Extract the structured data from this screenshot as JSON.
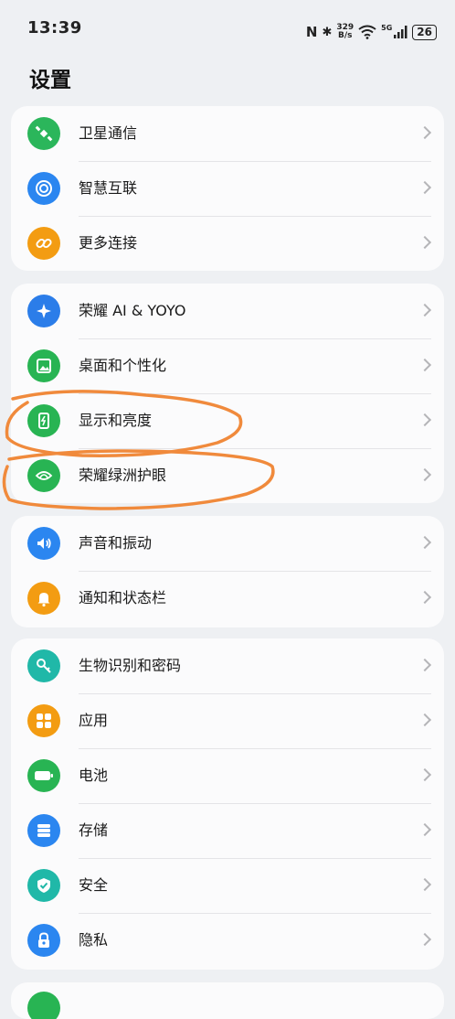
{
  "status_bar": {
    "time": "13:39",
    "nfc": "N",
    "bluetooth": "✱",
    "speed_top": "329",
    "speed_bottom": "B/s",
    "signal_label": "5G",
    "battery": "26"
  },
  "page": {
    "title": "设置"
  },
  "groups": [
    {
      "items": [
        {
          "label": "卫星通信",
          "icon": "satellite-icon",
          "color": "#2bb65b"
        },
        {
          "label": "智慧互联",
          "icon": "smart-link-icon",
          "color": "#2b86f0"
        },
        {
          "label": "更多连接",
          "icon": "link-icon",
          "color": "#f39c12"
        }
      ]
    },
    {
      "items": [
        {
          "label": "荣耀 AI & YOYO",
          "icon": "ai-assistant-icon",
          "color": "#2b7de9"
        },
        {
          "label": "桌面和个性化",
          "icon": "picture-icon",
          "color": "#28b453"
        },
        {
          "label": "显示和亮度",
          "icon": "display-brightness-icon",
          "color": "#28b453"
        },
        {
          "label": "荣耀绿洲护眼",
          "icon": "eye-care-icon",
          "color": "#28b453"
        }
      ]
    },
    {
      "items": [
        {
          "label": "声音和振动",
          "icon": "speaker-icon",
          "color": "#2b86f0"
        },
        {
          "label": "通知和状态栏",
          "icon": "bell-icon",
          "color": "#f39c12"
        }
      ]
    },
    {
      "items": [
        {
          "label": "生物识别和密码",
          "icon": "key-icon",
          "color": "#20b8a8"
        },
        {
          "label": "应用",
          "icon": "apps-grid-icon",
          "color": "#f39c12"
        },
        {
          "label": "电池",
          "icon": "battery-icon",
          "color": "#28b453"
        },
        {
          "label": "存储",
          "icon": "storage-icon",
          "color": "#2b86f0"
        },
        {
          "label": "安全",
          "icon": "shield-check-icon",
          "color": "#20b8a8"
        },
        {
          "label": "隐私",
          "icon": "privacy-lock-icon",
          "color": "#2b86f0"
        }
      ]
    }
  ],
  "annotation_color": "#f08a3c"
}
